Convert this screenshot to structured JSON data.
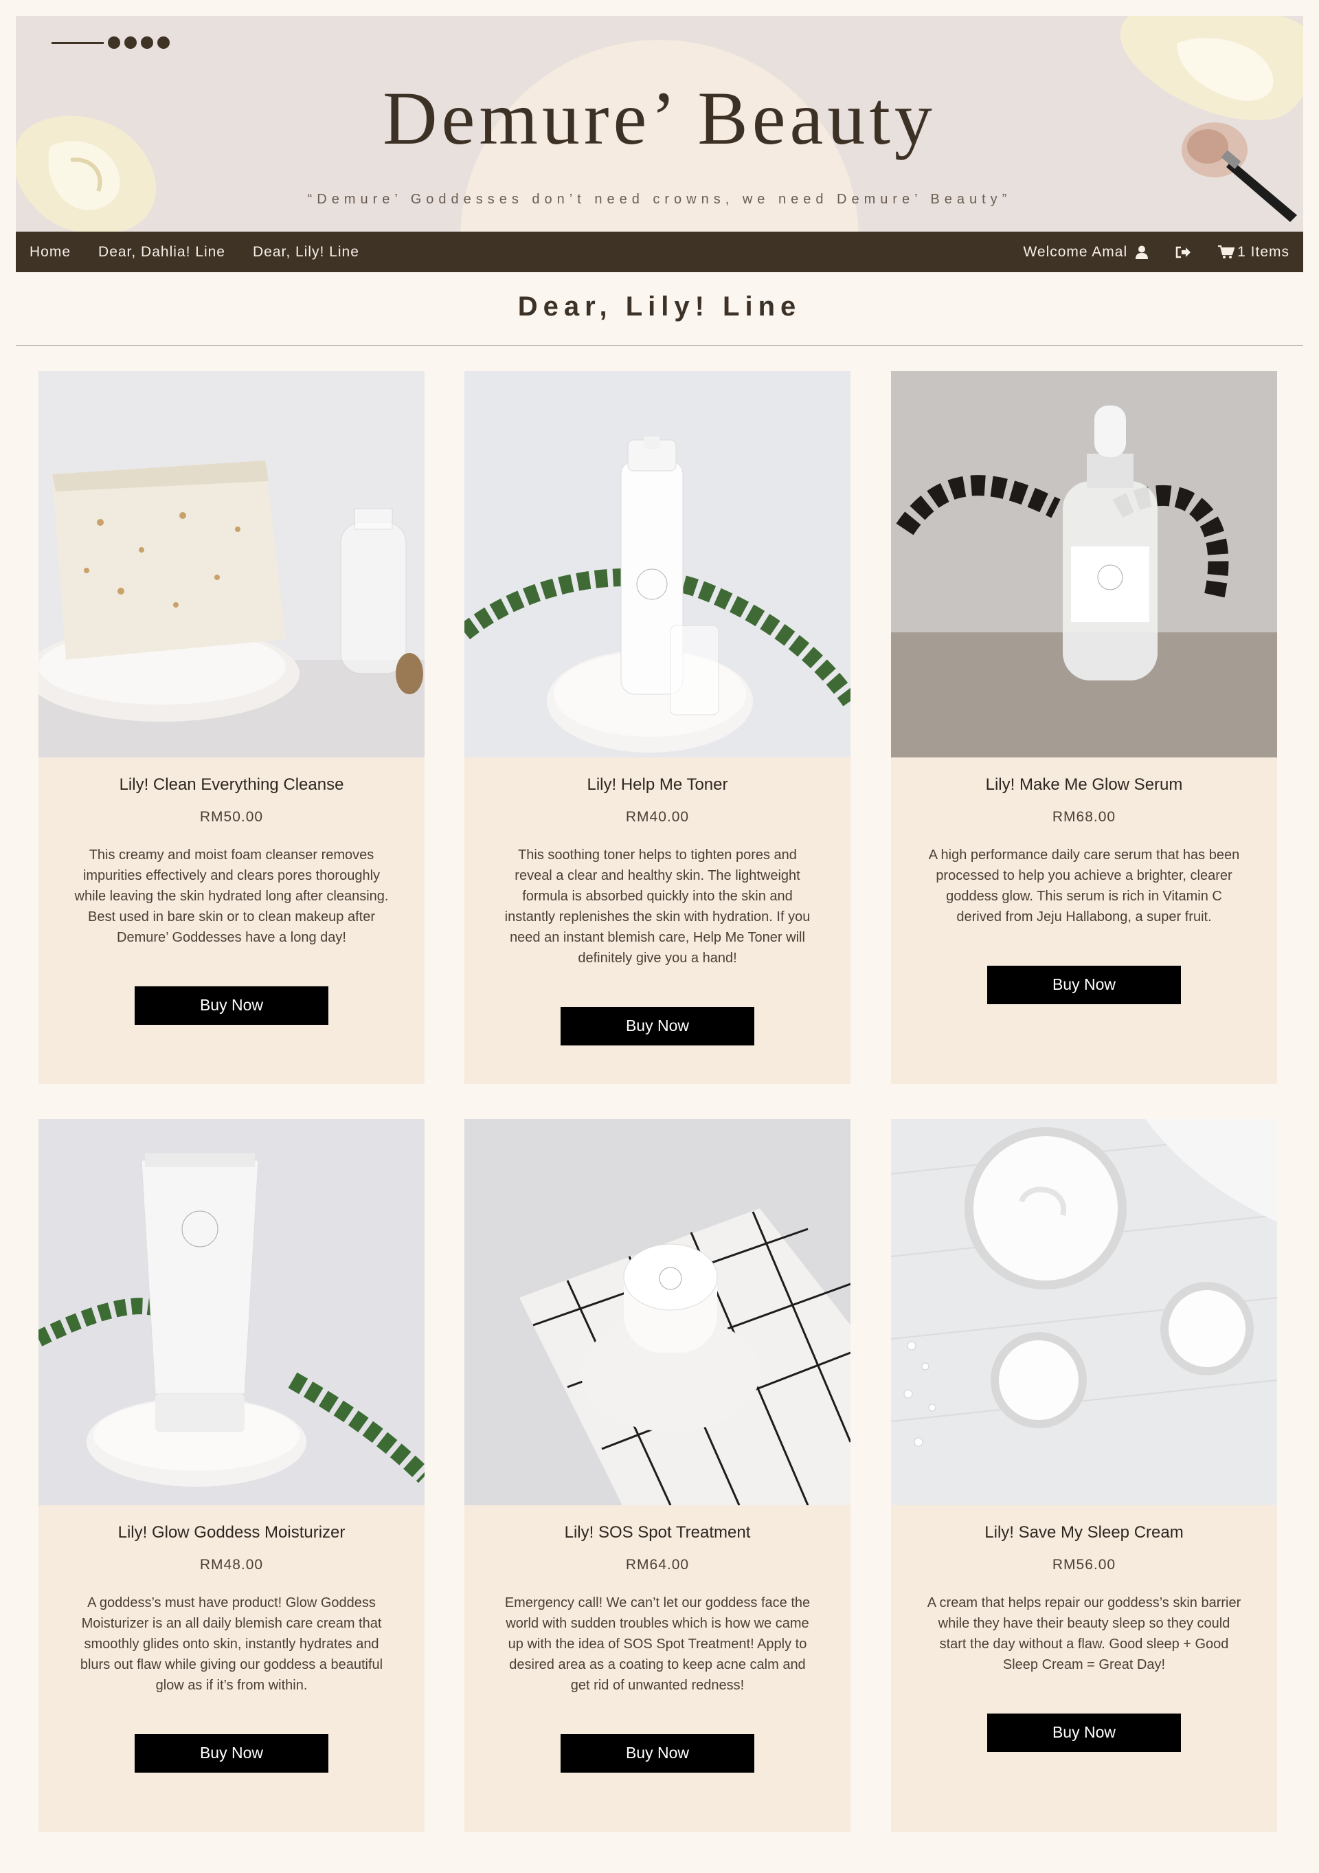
{
  "banner": {
    "title": "Demure’ Beauty",
    "tagline": "“Demure’ Goddesses don’t need crowns, we need Demure’ Beauty”"
  },
  "nav": {
    "links": [
      "Home",
      "Dear, Dahlia! Line",
      "Dear, Lily! Line"
    ],
    "welcome": "Welcome Amal",
    "cart": "1 Items",
    "icons": [
      "user-icon",
      "logout-icon",
      "cart-icon"
    ]
  },
  "page": {
    "title": "Dear, Lily! Line"
  },
  "products": [
    {
      "name": "Lily! Clean Everything Cleanse",
      "price": "RM50.00",
      "description": "This creamy and moist foam cleanser removes impurities effectively and clears pores thoroughly while leaving the skin hydrated long after cleansing. Best used in bare skin or to clean makeup after Demure’ Goddesses have a long day!",
      "button": "Buy Now"
    },
    {
      "name": "Lily! Help Me Toner",
      "price": "RM40.00",
      "description": "This soothing toner helps to tighten pores and reveal a clear and healthy skin. The lightweight formula is absorbed quickly into the skin and instantly replenishes the skin with hydration. If you need an instant blemish care, Help Me Toner will definitely give you a hand!",
      "button": "Buy Now"
    },
    {
      "name": "Lily! Make Me Glow Serum",
      "price": "RM68.00",
      "description": "A high performance daily care serum that has been processed to help you achieve a brighter, clearer goddess glow. This serum is rich in Vitamin C derived from Jeju Hallabong, a super fruit.",
      "button": "Buy Now"
    },
    {
      "name": "Lily! Glow Goddess Moisturizer",
      "price": "RM48.00",
      "description": "A goddess’s must have product! Glow Goddess Moisturizer is an all daily blemish care cream that smoothly glides onto skin, instantly hydrates and blurs out flaw while giving our goddess a beautiful glow as if it’s from within.",
      "button": "Buy Now"
    },
    {
      "name": "Lily! SOS Spot Treatment",
      "price": "RM64.00",
      "description": "Emergency call! We can’t let our goddess face the world with sudden troubles which is how we came up with the idea of SOS Spot Treatment! Apply to desired area as a coating to keep acne calm and get rid of unwanted redness!",
      "button": "Buy Now"
    },
    {
      "name": "Lily! Save My Sleep Cream",
      "price": "RM56.00",
      "description": "A cream that helps repair our goddess’s skin barrier while they have their beauty sleep so they could start the day without a flaw. Good sleep + Good Sleep Cream = Great Day!",
      "button": "Buy Now"
    }
  ],
  "colors": {
    "background": "#fbf7f0",
    "nav": "#3f3326",
    "card": "#f7ebde",
    "button": "#000000",
    "banner": "#e8e0dd"
  }
}
